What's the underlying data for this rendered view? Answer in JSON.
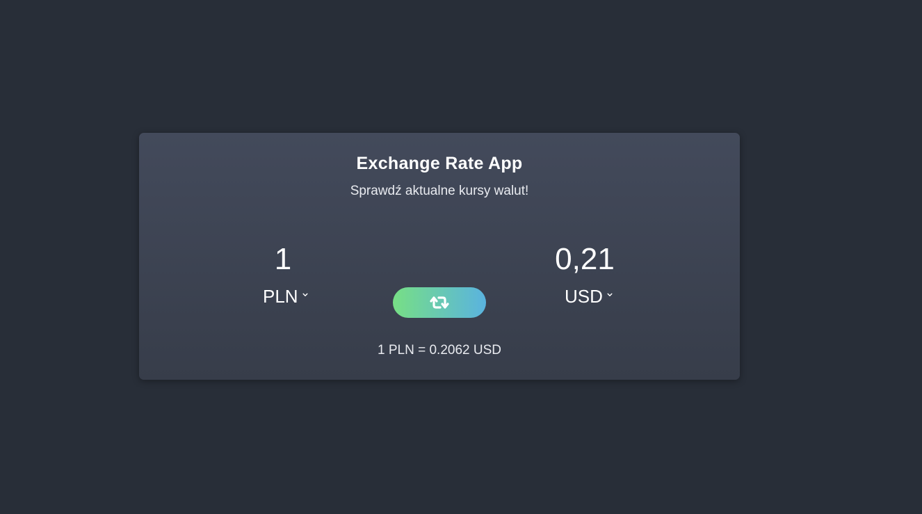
{
  "app": {
    "title": "Exchange Rate App",
    "subtitle": "Sprawdź aktualne kursy walut!"
  },
  "converter": {
    "from": {
      "amount": "1",
      "currency": "PLN"
    },
    "to": {
      "amount": "0,21",
      "currency": "USD"
    },
    "swap_icon": "swap-arrows-icon",
    "rate": {
      "base_amount": "1",
      "base_currency": "PLN",
      "equals": "=",
      "rate_value": "0.2062",
      "quote_currency": "USD"
    }
  },
  "colors": {
    "background": "#282e38",
    "card_top": "#434a5b",
    "card_bottom": "#373d4a",
    "swap_gradient_start": "#77df85",
    "swap_gradient_end": "#5ab3df"
  }
}
